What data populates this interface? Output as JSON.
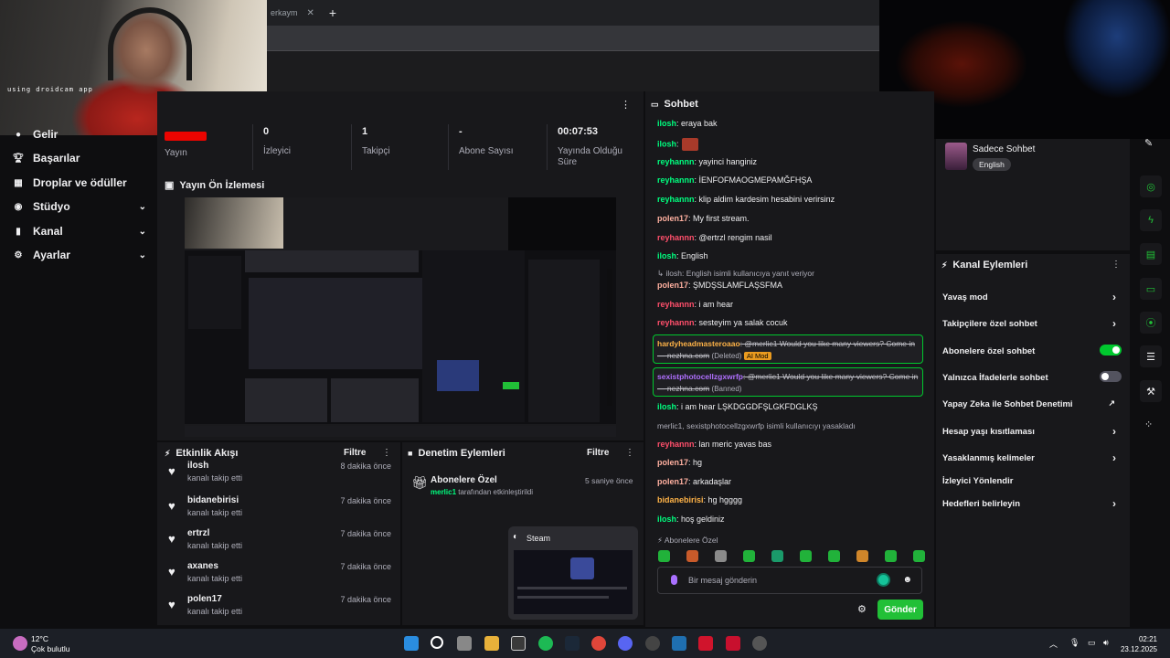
{
  "browser": {
    "tab_label": "erkaym",
    "close_glyph": "✕",
    "new_tab_glyph": "+"
  },
  "webcam": {
    "watermark": "using droidcam app"
  },
  "sidebar": {
    "items": [
      {
        "label": "Gelir",
        "icon": "coin-icon",
        "chev": ""
      },
      {
        "label": "Başarılar",
        "icon": "trophy-icon",
        "chev": ""
      },
      {
        "label": "Droplar ve ödüller",
        "icon": "gift-icon",
        "chev": ""
      },
      {
        "label": "Stüdyo",
        "icon": "camera-icon",
        "chev": "⌄"
      },
      {
        "label": "Kanal",
        "icon": "chart-icon",
        "chev": "⌄"
      },
      {
        "label": "Ayarlar",
        "icon": "gear-icon",
        "chev": "⌄"
      }
    ]
  },
  "stats": {
    "items": [
      {
        "value": "",
        "label": "Yayın"
      },
      {
        "value": "0",
        "label": "İzleyici"
      },
      {
        "value": "1",
        "label": "Takipçi"
      },
      {
        "value": "-",
        "label": "Abone Sayısı"
      },
      {
        "value": "00:07:53",
        "label": "Yayında Olduğu Süre"
      }
    ],
    "menu": "⋮"
  },
  "preview": {
    "title": "Yayın Ön İzlemesi"
  },
  "feed": {
    "title": "Etkinlik Akışı",
    "filter": "Filtre",
    "menu": "⋮",
    "items": [
      {
        "name": "ilosh",
        "sub": "kanalı takip etti",
        "time": "8 dakika önce"
      },
      {
        "name": "bidanebirisi",
        "sub": "kanalı takip etti",
        "time": "7 dakika önce"
      },
      {
        "name": "ertrzl",
        "sub": "kanalı takip etti",
        "time": "7 dakika önce"
      },
      {
        "name": "axanes",
        "sub": "kanalı takip etti",
        "time": "7 dakika önce"
      },
      {
        "name": "polen17",
        "sub": "kanalı takip etti",
        "time": "7 dakika önce"
      }
    ]
  },
  "moderation": {
    "title": "Denetim Eylemleri",
    "filter": "Filtre",
    "menu": "⋮",
    "entry_title": "Abonelere Özel",
    "entry_user": "merlic1",
    "entry_text": " tarafından etkinleştirildi",
    "entry_time": "5 saniye önce",
    "steam_label": "Steam"
  },
  "chat": {
    "title": "Sohbet",
    "messages": [
      {
        "user": "ilosh",
        "color": "#00ff7f",
        "text": ": eraya bak"
      },
      {
        "user": "ilosh",
        "color": "#00ff7f",
        "text": ":"
      },
      {
        "user": "reyhannn",
        "color": "#00ff7f",
        "text": ": yayinci hanginiz"
      },
      {
        "user": "reyhannn",
        "color": "#00ff7f",
        "text": ": İENFOFMAOGMEPAMĞFHŞA"
      },
      {
        "user": "reyhannn",
        "color": "#00ff7f",
        "text": ": klip aldim kardesim hesabini verirsinz"
      },
      {
        "user": "polen17",
        "color": "#ffb0a0",
        "text": ": My first stream."
      },
      {
        "user": "reyhannn",
        "color": "#ff4f6b",
        "text": ": @ertrzl rengim nasil"
      },
      {
        "user": "ilosh",
        "color": "#00ff7f",
        "text": ": English"
      },
      {
        "user": "",
        "color": "#adadb8",
        "text": "↳ ilosh: English isimli kullanıcıya yanıt veriyor"
      },
      {
        "user": "polen17",
        "color": "#ffb0a0",
        "text": ": ŞMDŞSLAMFLAŞSFMA"
      },
      {
        "user": "reyhannn",
        "color": "#ff4f6b",
        "text": ": i am hear"
      },
      {
        "user": "reyhannn",
        "color": "#ff4f6b",
        "text": ": sesteyim ya salak cocuk"
      },
      {
        "user": "ilosh",
        "color": "#00ff7f",
        "text": ": i am hear LŞKDGGDFŞLGKFDGLKŞ"
      },
      {
        "user": "",
        "color": "#adadb8",
        "text": "merlic1, sexistphotocellzgxwrfp isimli kullanıcıyı yasakladı"
      },
      {
        "user": "reyhannn",
        "color": "#ff4f6b",
        "text": ": lan meric yavas bas"
      },
      {
        "user": "polen17",
        "color": "#ffb0a0",
        "text": ": hg"
      },
      {
        "user": "polen17",
        "color": "#ffb0a0",
        "text": ": arkadaşlar"
      },
      {
        "user": "bidanebirisi",
        "color": "#ffb347",
        "text": ": hg hgggg"
      },
      {
        "user": "ilosh",
        "color": "#00ff7f",
        "text": ": hoş geldiniz"
      }
    ],
    "deleted1": {
      "user": "hardyheadmasteroaao",
      "color": "#ffb347",
      "text": ": @merlic1 Would you like many viewers? Come in — nezhna.com",
      "tag": "(Deleted)",
      "ai": "AI Mod"
    },
    "deleted2": {
      "user": "sexistphotocellzgxwrfp",
      "color": "#b070ff",
      "text": ": @merlic1 Would you like many viewers? Come in — nezhna.com",
      "tag": "(Banned)"
    },
    "subs_only": "Abonelere Özel",
    "input_placeholder": "Bir mesaj gönderin",
    "send": "Gönder"
  },
  "right_panel": {
    "channel_name": "Sadece Sohbet",
    "language": "English",
    "actions_title": "Kanal Eylemleri",
    "actions": [
      {
        "label": "Yavaş mod",
        "kind": "chevron"
      },
      {
        "label": "Takipçilere özel sohbet",
        "kind": "chevron"
      },
      {
        "label": "Abonelere özel sohbet",
        "kind": "toggle-on"
      },
      {
        "label": "Yalnızca İfadelerle sohbet",
        "kind": "toggle-off"
      },
      {
        "label": "Yapay Zeka ile Sohbet Denetimi",
        "kind": "external"
      },
      {
        "label": "Hesap yaşı kısıtlaması",
        "kind": "chevron"
      },
      {
        "label": "Yasaklanmış kelimeler",
        "kind": "chevron"
      },
      {
        "label": "İzleyici Yönlendir",
        "kind": "none"
      },
      {
        "label": "Hedefleri belirleyin",
        "kind": "chevron"
      }
    ],
    "accent_green": "#00c82e"
  },
  "taskbar": {
    "temp": "12°C",
    "weather": "Çok bulutlu",
    "time": "02:21",
    "date": "23.12.2025"
  }
}
